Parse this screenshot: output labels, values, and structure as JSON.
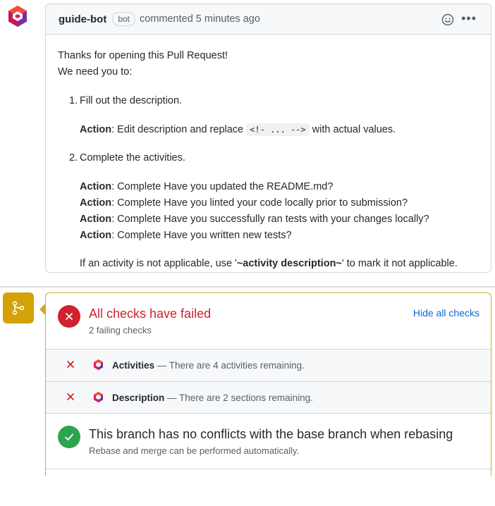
{
  "comment": {
    "author": "guide-bot",
    "badge": "bot",
    "meta": "commented 5 minutes ago",
    "intro_line1": "Thanks for opening this Pull Request!",
    "intro_line2": "We need you to:",
    "items": [
      {
        "number": "1.",
        "text": "Fill out the description.",
        "actions": [
          {
            "label": "Action",
            "pre": ": Edit description and replace ",
            "code": "<!- ... -->",
            "post": " with actual values."
          }
        ]
      },
      {
        "number": "2.",
        "text": "Complete the activities.",
        "actions": [
          {
            "label": "Action",
            "text": ": Complete Have you updated the README.md?"
          },
          {
            "label": "Action",
            "text": ": Complete Have you linted your code locally prior to submission?"
          },
          {
            "label": "Action",
            "text": ": Complete Have you successfully ran tests with your changes locally?"
          },
          {
            "label": "Action",
            "text": ": Complete Have you written new tests?"
          }
        ]
      }
    ],
    "footer_pre": "If an activity is not applicable, use '",
    "footer_bold": "~activity description~",
    "footer_post": "' to mark it not applicable."
  },
  "checks": {
    "status_title": "All checks have failed",
    "status_sub": "2 failing checks",
    "hide_link": "Hide all checks",
    "rows": [
      {
        "name": "Activities",
        "desc": " — There are 4 activities remaining."
      },
      {
        "name": "Description",
        "desc": " — There are 2 sections remaining."
      }
    ]
  },
  "merge": {
    "title": "This branch has no conflicts with the base branch when rebasing",
    "sub": "Rebase and merge can be performed automatically."
  },
  "colors": {
    "fail": "#cf222e",
    "success": "#2da44e",
    "warning_box": "#d4a72c",
    "link": "#0969da"
  },
  "icons": {
    "avatar": "guide-bot-logo-icon",
    "reaction": "smiley-icon",
    "menu": "kebab-icon",
    "merge": "git-merge-icon",
    "fail": "x-circle-icon",
    "check_fail": "x-icon",
    "success": "check-circle-icon"
  }
}
